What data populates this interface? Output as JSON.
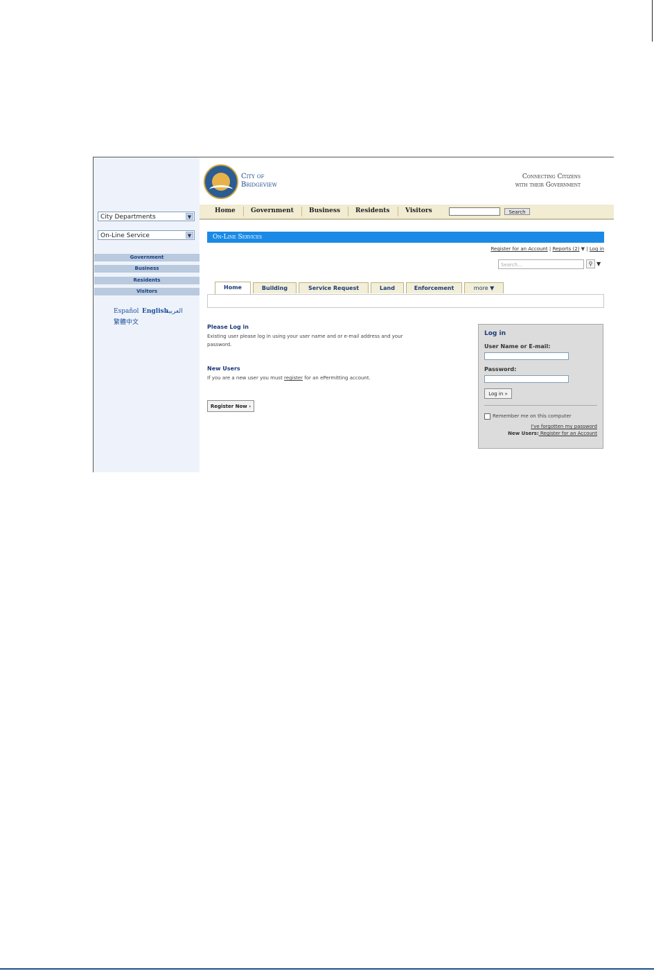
{
  "sidebar": {
    "select1": "City Departments",
    "select2": "On-Line Service",
    "nav": [
      "Government",
      "Business",
      "Residents",
      "Visitors"
    ],
    "lang": {
      "es": "Español",
      "en": "English",
      "ar": "العربية",
      "zh": "繁體中文"
    }
  },
  "header": {
    "brand_line1": "City of",
    "brand_line2": "Bridgeview",
    "tagline_line1": "Connecting Citizens",
    "tagline_line2": "with their Government"
  },
  "topnav": {
    "items": [
      "Home",
      "Government",
      "Business",
      "Residents",
      "Visitors"
    ],
    "search_button": "Search"
  },
  "banner": "On-Line Services",
  "toplinks": {
    "register": "Register for an Account",
    "reports": "Reports (2)",
    "login": "Log in",
    "search_placeholder": "Search..."
  },
  "tabs": [
    "Home",
    "Building",
    "Service Request",
    "Land",
    "Enforcement",
    "more"
  ],
  "content": {
    "please_login_title": "Please Log in",
    "please_login_text1": "Existing user please log in using your user name and or e-mail address and your",
    "please_login_text2": "password.",
    "new_users_title": "New Users",
    "new_users_pre": "If you are a new user you must ",
    "new_users_link": "register",
    "new_users_post": " for an ePermitting account.",
    "register_button": "Register Now ›"
  },
  "login": {
    "title": "Log in",
    "user_label": "User Name or E-mail:",
    "password_label": "Password:",
    "button": "Log in »",
    "remember": "Remember me on this computer",
    "forgot": "I've forgotten my password",
    "new_users_bold": "New Users:",
    "new_users_link": " Register for an Account"
  }
}
